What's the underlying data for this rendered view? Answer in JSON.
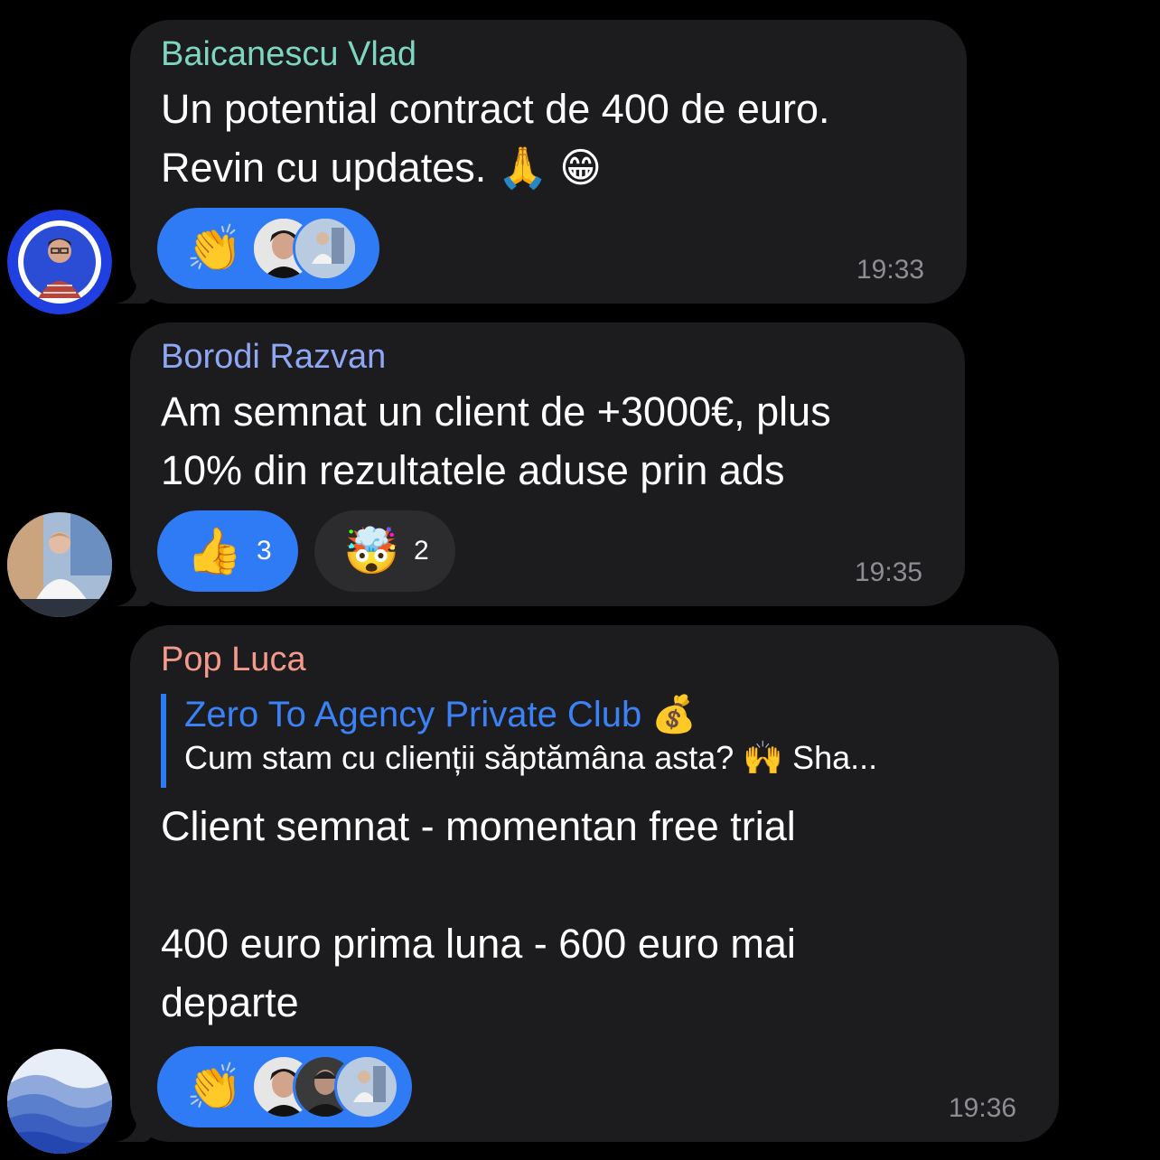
{
  "colors": {
    "background": "#000000",
    "bubble": "#1c1c1e",
    "reaction_blue": "#2f7bf5",
    "reaction_dark": "#2c2c2e",
    "timestamp": "#8d8d93",
    "quote_accent": "#3b82f6"
  },
  "messages": [
    {
      "sender": "Baicanescu Vlad",
      "sender_color": "#7ed6c0",
      "text": "Un potential contract de 400 de euro.\nRevin cu updates. 🙏 😁",
      "time": "19:33",
      "reactions": [
        {
          "emoji": "👏",
          "avatars": [
            "avatar-dark-hair",
            "avatar-sitting-person"
          ]
        }
      ]
    },
    {
      "sender": "Borodi Razvan",
      "sender_color": "#8fa6f5",
      "text": "Am semnat un client de +3000€, plus\n10% din rezultatele aduse prin ads",
      "time": "19:35",
      "reactions": [
        {
          "emoji": "👍",
          "count": "3"
        },
        {
          "emoji": "🤯",
          "count": "2"
        }
      ]
    },
    {
      "sender": "Pop Luca",
      "sender_color": "#f49a8c",
      "reply": {
        "title": "Zero To Agency Private Club 💰",
        "text": "Cum stam cu clienții săptămâna asta? 🙌  Sha..."
      },
      "text": "Client semnat - momentan free trial\n\n400 euro prima luna - 600 euro mai\ndeparte",
      "time": "19:36",
      "reactions": [
        {
          "emoji": "👏",
          "avatars": [
            "avatar-dark-hair",
            "avatar-dark-shirt",
            "avatar-sitting-person"
          ]
        }
      ]
    }
  ]
}
